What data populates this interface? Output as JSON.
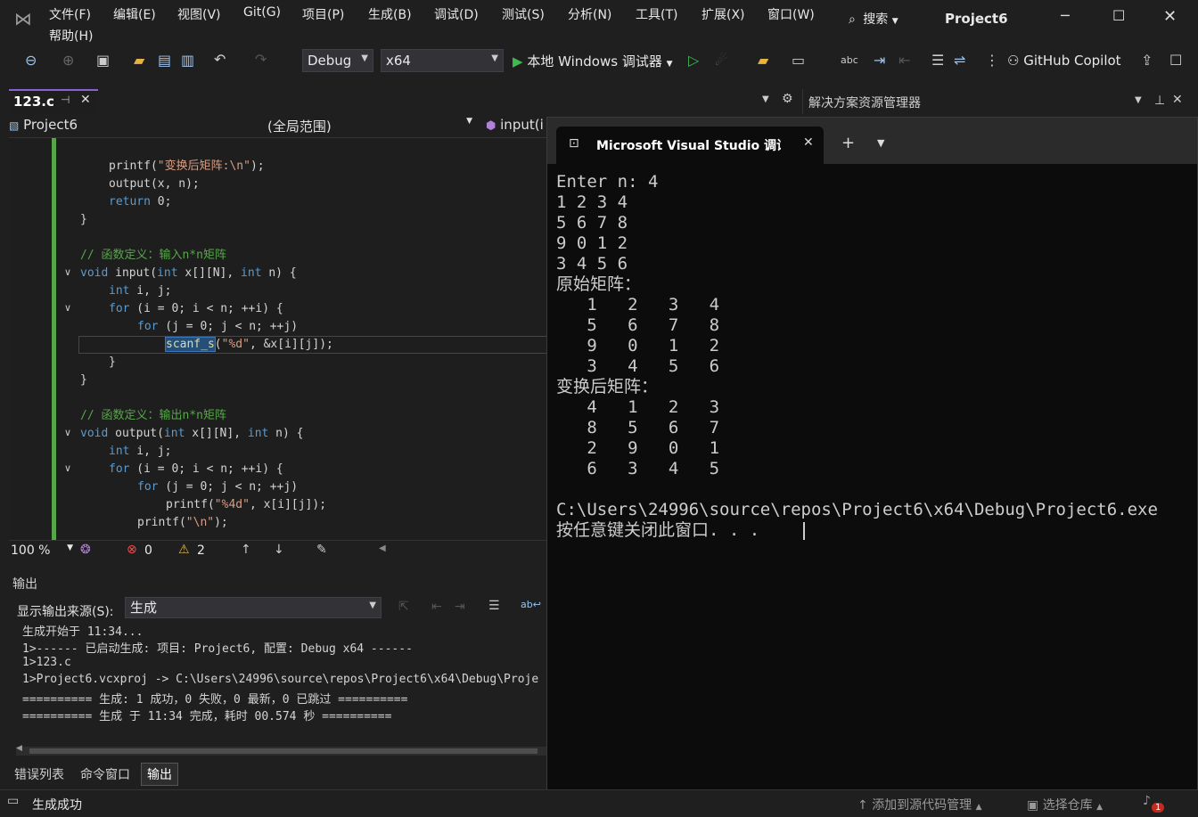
{
  "menubar": {
    "items": [
      "文件(F)",
      "编辑(E)",
      "视图(V)",
      "Git(G)",
      "项目(P)",
      "生成(B)",
      "调试(D)",
      "测试(S)",
      "分析(N)",
      "工具(T)",
      "扩展(X)",
      "窗口(W)"
    ],
    "help": "帮助(H)",
    "search_label": "搜索",
    "project_name": "Project6"
  },
  "toolbar": {
    "config": "Debug",
    "platform": "x64",
    "run_label": "本地 Windows 调试器",
    "copilot_label": "GitHub Copilot"
  },
  "doc_tab": {
    "title": "123.c"
  },
  "editor_nav": {
    "project": "Project6",
    "scope": "(全局范围)",
    "member": "input(i"
  },
  "code_lines": [
    {
      "indent": 1,
      "parts": [
        {
          "t": "printf(",
          "c": ""
        },
        {
          "t": "\"变换后矩阵:\\n\"",
          "c": "st"
        },
        {
          "t": ");",
          "c": ""
        }
      ]
    },
    {
      "indent": 1,
      "parts": [
        {
          "t": "output(x, n);",
          "c": ""
        }
      ]
    },
    {
      "indent": 1,
      "parts": [
        {
          "t": "return",
          "c": "kw"
        },
        {
          "t": " 0;",
          "c": ""
        }
      ]
    },
    {
      "indent": 0,
      "parts": [
        {
          "t": "}",
          "c": ""
        }
      ]
    },
    {
      "indent": 0,
      "parts": [
        {
          "t": "",
          "c": ""
        }
      ]
    },
    {
      "indent": 0,
      "parts": [
        {
          "t": "// 函数定义：输入n*n矩阵",
          "c": "cm"
        }
      ]
    },
    {
      "indent": 0,
      "parts": [
        {
          "t": "void",
          "c": "kw"
        },
        {
          "t": " input(",
          "c": ""
        },
        {
          "t": "int",
          "c": "kw"
        },
        {
          "t": " x[][N], ",
          "c": ""
        },
        {
          "t": "int",
          "c": "kw"
        },
        {
          "t": " n) {",
          "c": ""
        }
      ]
    },
    {
      "indent": 1,
      "parts": [
        {
          "t": "int",
          "c": "kw"
        },
        {
          "t": " i, j;",
          "c": ""
        }
      ]
    },
    {
      "indent": 1,
      "parts": [
        {
          "t": "for",
          "c": "kw"
        },
        {
          "t": " (i = 0; i < n; ++i) {",
          "c": ""
        }
      ]
    },
    {
      "indent": 2,
      "parts": [
        {
          "t": "for",
          "c": "kw"
        },
        {
          "t": " (j = 0; j < n; ++j)",
          "c": ""
        }
      ]
    },
    {
      "indent": 3,
      "parts": [
        {
          "t": "scanf_s",
          "c": "sel"
        },
        {
          "t": "(",
          "c": ""
        },
        {
          "t": "\"%d\"",
          "c": "st"
        },
        {
          "t": ", &x[i][j]);",
          "c": ""
        }
      ]
    },
    {
      "indent": 1,
      "parts": [
        {
          "t": "}",
          "c": ""
        }
      ]
    },
    {
      "indent": 0,
      "parts": [
        {
          "t": "}",
          "c": ""
        }
      ]
    },
    {
      "indent": 0,
      "parts": [
        {
          "t": "",
          "c": ""
        }
      ]
    },
    {
      "indent": 0,
      "parts": [
        {
          "t": "// 函数定义：输出n*n矩阵",
          "c": "cm"
        }
      ]
    },
    {
      "indent": 0,
      "parts": [
        {
          "t": "void",
          "c": "kw"
        },
        {
          "t": " output(",
          "c": ""
        },
        {
          "t": "int",
          "c": "kw"
        },
        {
          "t": " x[][N], ",
          "c": ""
        },
        {
          "t": "int",
          "c": "kw"
        },
        {
          "t": " n) {",
          "c": ""
        }
      ]
    },
    {
      "indent": 1,
      "parts": [
        {
          "t": "int",
          "c": "kw"
        },
        {
          "t": " i, j;",
          "c": ""
        }
      ]
    },
    {
      "indent": 1,
      "parts": [
        {
          "t": "for",
          "c": "kw"
        },
        {
          "t": " (i = 0; i < n; ++i) {",
          "c": ""
        }
      ]
    },
    {
      "indent": 2,
      "parts": [
        {
          "t": "for",
          "c": "kw"
        },
        {
          "t": " (j = 0; j < n; ++j)",
          "c": ""
        }
      ]
    },
    {
      "indent": 3,
      "parts": [
        {
          "t": "printf(",
          "c": ""
        },
        {
          "t": "\"%4d\"",
          "c": "st"
        },
        {
          "t": ", x[i][j]);",
          "c": ""
        }
      ]
    },
    {
      "indent": 2,
      "parts": [
        {
          "t": "printf(",
          "c": ""
        },
        {
          "t": "\"\\n\"",
          "c": "st"
        },
        {
          "t": ");",
          "c": ""
        }
      ]
    }
  ],
  "editor_status": {
    "zoom": "100 %",
    "errors": "0",
    "warnings": "2"
  },
  "output": {
    "title": "输出",
    "source_label": "显示输出来源(S):",
    "source_value": "生成",
    "lines": [
      "生成开始于 11:34...",
      "1>------ 已启动生成: 项目: Project6, 配置: Debug x64 ------",
      "1>123.c",
      "1>Project6.vcxproj -> C:\\Users\\24996\\source\\repos\\Project6\\x64\\Debug\\Proje",
      "========== 生成: 1 成功，0 失败，0 最新，0 已跳过 ==========",
      "========== 生成 于 11:34 完成，耗时 00.574 秒 =========="
    ]
  },
  "bottom_tabs": [
    "错误列表",
    "命令窗口",
    "输出"
  ],
  "solution_explorer": {
    "title": "解决方案资源管理器"
  },
  "console": {
    "tab_title": "Microsoft Visual Studio 调试控",
    "lines": [
      "Enter n: 4",
      "1 2 3 4",
      "5 6 7 8",
      "9 0 1 2",
      "3 4 5 6",
      "原始矩阵：",
      "   1   2   3   4",
      "   5   6   7   8",
      "   9   0   1   2",
      "   3   4   5   6",
      "变换后矩阵：",
      "   4   1   2   3",
      "   8   5   6   7",
      "   2   9   0   1",
      "   6   3   4   5",
      "",
      "C:\\Users\\24996\\source\\repos\\Project6\\x64\\Debug\\Project6.exe",
      "按任意键关闭此窗口. . ."
    ]
  },
  "statusbar": {
    "status": "生成成功",
    "add_source": "添加到源代码管理",
    "select_repo": "选择仓库",
    "notif_count": "1"
  }
}
